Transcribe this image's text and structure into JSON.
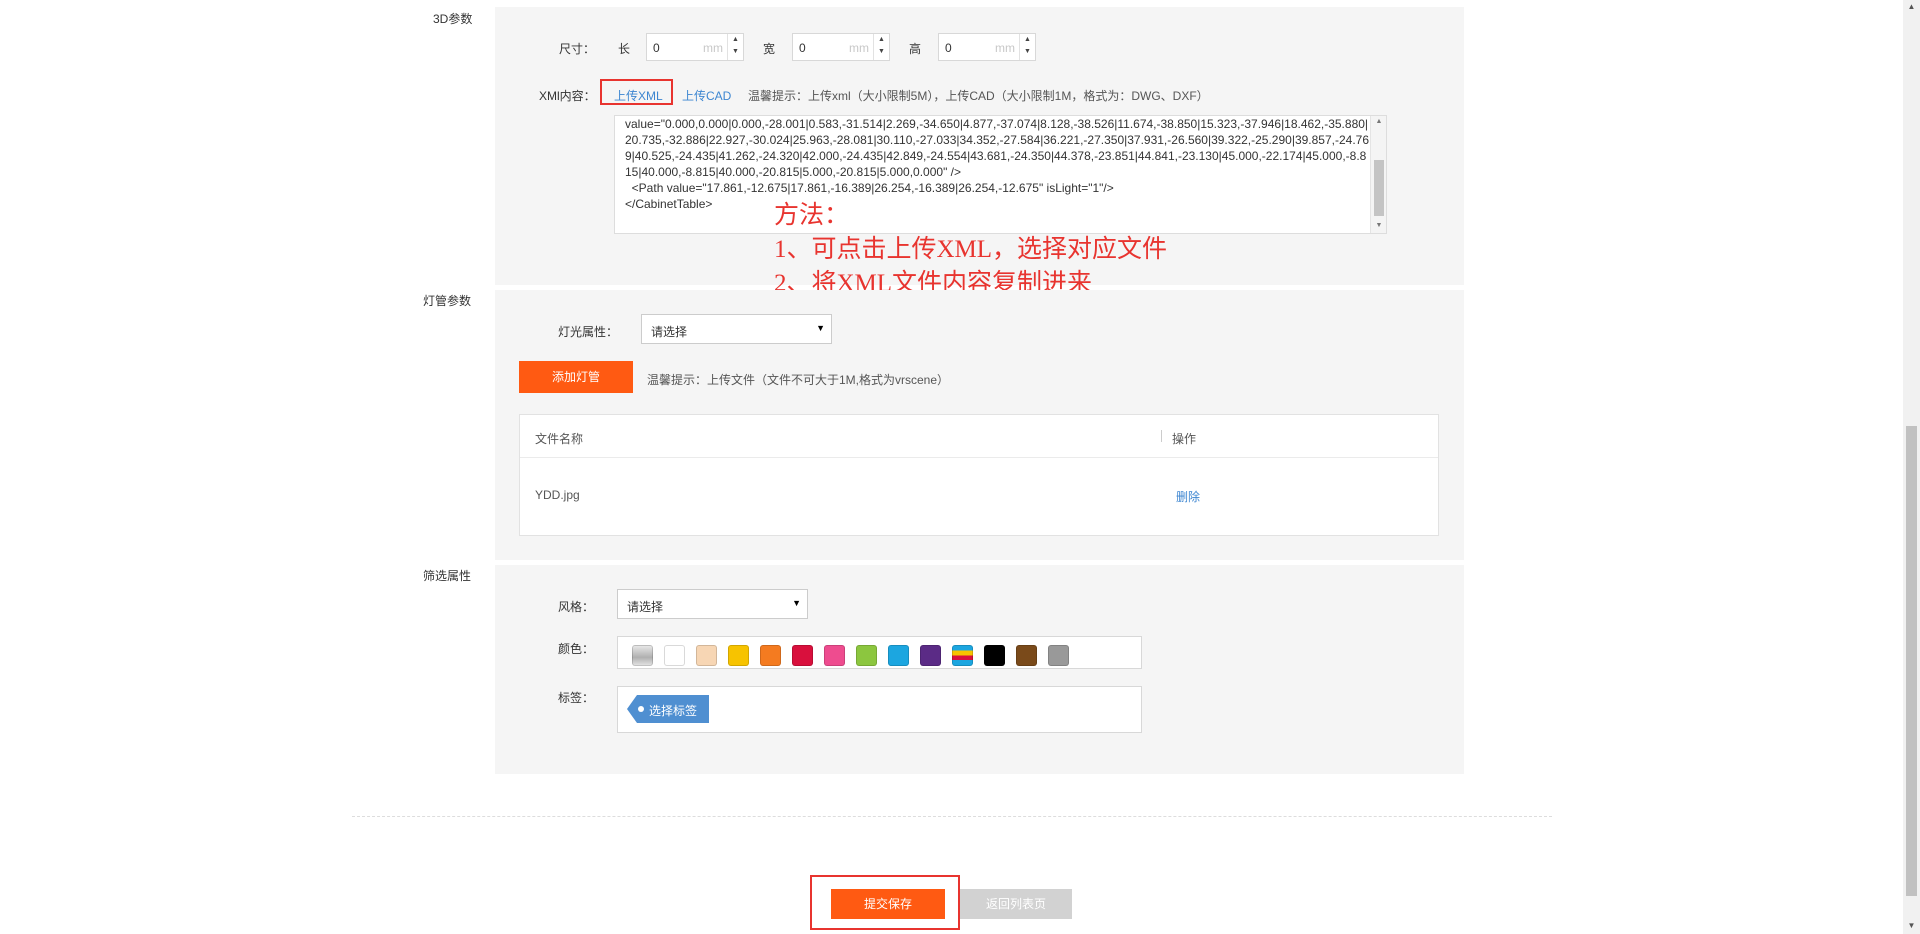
{
  "sections": {
    "params_3d": "3D参数",
    "lamp_params": "灯管参数",
    "filter_attrs": "筛选属性"
  },
  "size": {
    "label": "尺寸：",
    "length_label": "长",
    "width_label": "宽",
    "height_label": "高",
    "length_value": "0",
    "width_value": "0",
    "height_value": "0",
    "unit": "mm"
  },
  "xml": {
    "label": "XMl内容：",
    "upload_xml": "上传XML",
    "upload_cad": "上传CAD",
    "tip": "温馨提示：上传xml（大小限制5M），上传CAD（大小限制1M，格式为：DWG、DXF）",
    "content": "value=\"0.000,0.000|0.000,-28.001|0.583,-31.514|2.269,-34.650|4.877,-37.074|8.128,-38.526|11.674,-38.850|15.323,-37.946|18.462,-35.880|20.735,-32.886|22.927,-30.024|25.963,-28.081|30.110,-27.033|34.352,-27.584|36.221,-27.350|37.931,-26.560|39.322,-25.290|39.857,-24.769|40.525,-24.435|41.262,-24.320|42.000,-24.435|42.849,-24.554|43.681,-24.350|44.378,-23.851|44.841,-23.130|45.000,-22.174|45.000,-8.815|40.000,-8.815|40.000,-20.815|5.000,-20.815|5.000,0.000\" />\n  <Path value=\"17.861,-12.675|17.861,-16.389|26.254,-16.389|26.254,-12.675\" isLight=\"1\"/>\n</CabinetTable>"
  },
  "annotation": {
    "line1": "方法：",
    "line2": "1、可点击上传XML，选择对应文件",
    "line3": "2、将XML文件内容复制进来"
  },
  "lamp": {
    "light_attr_label": "灯光属性：",
    "light_attr_value": "请选择",
    "add_button": "添加灯管",
    "tip": "温馨提示：上传文件（文件不可大于1M,格式为vrscene）",
    "table": {
      "col_name": "文件名称",
      "col_action": "操作",
      "rows": [
        {
          "name": "YDD.jpg",
          "action": "删除"
        }
      ]
    }
  },
  "filter": {
    "style_label": "风格：",
    "style_value": "请选择",
    "color_label": "颜色：",
    "colors": [
      "#b0b0b0",
      "#ffffff",
      "#f7d6b4",
      "#f7c300",
      "#f47b20",
      "#d9103d",
      "#ee4c8f",
      "#8cc63f",
      "#1ca6e0",
      "#5b2b86",
      "multicolor",
      "#000000",
      "#7a4a1a",
      "#999999"
    ],
    "tag_label": "标签：",
    "tag_button": "选择标签"
  },
  "footer": {
    "submit": "提交保存",
    "back": "返回列表页"
  }
}
